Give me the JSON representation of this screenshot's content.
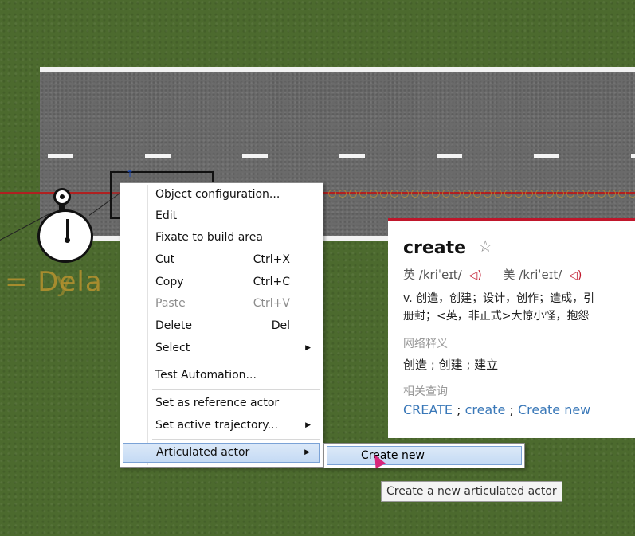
{
  "scene": {
    "delay_text": "= Dela",
    "delay_ghost": "y"
  },
  "dictionary": {
    "word": "create",
    "star_icon": "star-outline-icon",
    "phonetic_uk_label": "英",
    "phonetic_uk": "/kriˈeɪt/",
    "phonetic_us_label": "美",
    "phonetic_us": "/kriˈeɪt/",
    "definition_line1": "v. 创造，创建；设计，创作；造成，引",
    "definition_line2": "册封；<英，非正式>大惊小怪，抱怨",
    "web_section": "网络释义",
    "web_meanings": "创造 ; 创建 ; 建立",
    "related_section": "相关查询",
    "related": [
      "CREATE",
      "create",
      "Create new"
    ],
    "accent_color": "#c0162b",
    "link_color": "#3a78b8"
  },
  "menu": {
    "items": [
      {
        "label": "Object configuration..."
      },
      {
        "label": "Edit"
      },
      {
        "label": "Fixate to build area"
      },
      {
        "label": "Cut",
        "shortcut": "Ctrl+X"
      },
      {
        "label": "Copy",
        "shortcut": "Ctrl+C"
      },
      {
        "label": "Paste",
        "shortcut": "Ctrl+V",
        "disabled": true
      },
      {
        "label": "Delete",
        "shortcut": "Del"
      },
      {
        "label": "Select",
        "submenu": true
      },
      {
        "label": "Test Automation..."
      },
      {
        "label": "Set as reference actor"
      },
      {
        "label": "Set active trajectory...",
        "submenu": true
      },
      {
        "label": "Articulated actor",
        "submenu": true,
        "highlighted": true
      }
    ]
  },
  "submenu": {
    "items": [
      {
        "label": "Create new",
        "highlighted": true
      }
    ]
  },
  "tooltip": "Create a new articulated actor"
}
